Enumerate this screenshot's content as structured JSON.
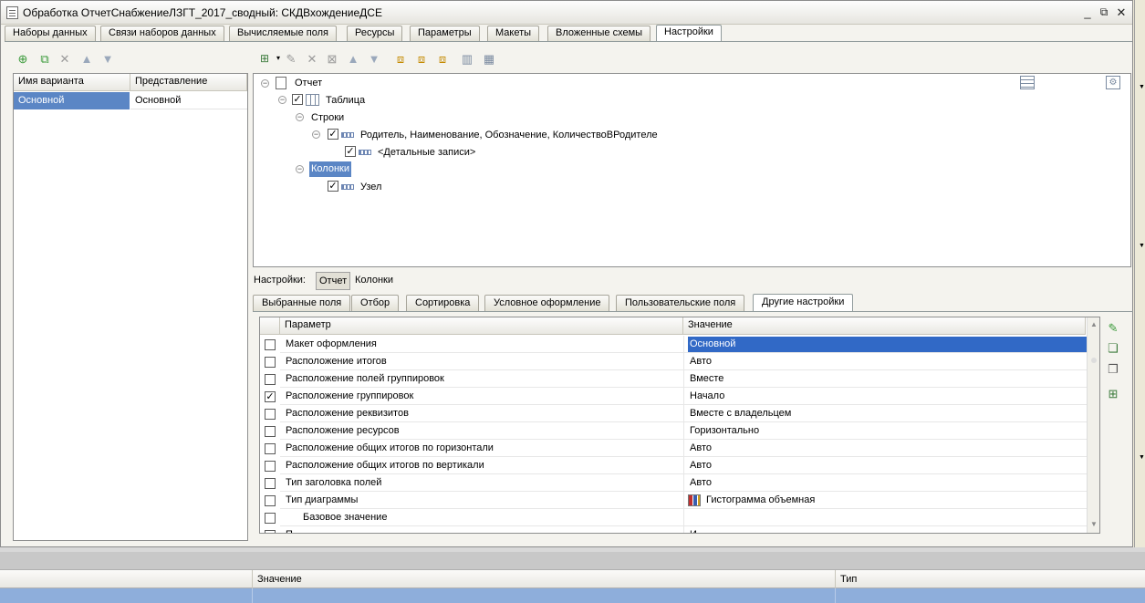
{
  "window": {
    "title": "Обработка ОтчетСнабжениеЛЗГТ_2017_сводный: СКДВхождениеДСЕ"
  },
  "tabs": [
    "Наборы данных",
    "Связи наборов данных",
    "Вычисляемые поля",
    "Ресурсы",
    "Параметры",
    "Макеты",
    "Вложенные схемы",
    "Настройки"
  ],
  "active_tab": "Настройки",
  "variants": {
    "col_name": "Имя варианта",
    "col_repr": "Представление",
    "rows": [
      {
        "name": "Основной",
        "repr": "Основной"
      }
    ]
  },
  "tree": {
    "root": "Отчет",
    "table": "Таблица",
    "rows": "Строки",
    "grouping": "Родитель, Наименование, Обозначение, КоличествоВРодителе",
    "detail": "<Детальные записи>",
    "columns": "Колонки",
    "node": "Узел"
  },
  "settings_bar": {
    "label": "Настройки:",
    "btn1": "Отчет",
    "btn2": "Колонки"
  },
  "subtabs": [
    "Выбранные поля",
    "Отбор",
    "Сортировка",
    "Условное оформление",
    "Пользовательские поля",
    "Другие настройки"
  ],
  "active_subtab": "Другие настройки",
  "params": {
    "col_param": "Параметр",
    "col_value": "Значение",
    "rows": [
      {
        "param": "Макет оформления",
        "value": "Основной",
        "checked": false,
        "selected": true
      },
      {
        "param": "Расположение итогов",
        "value": "Авто",
        "checked": false
      },
      {
        "param": "Расположение полей группировок",
        "value": "Вместе",
        "checked": false
      },
      {
        "param": "Расположение группировок",
        "value": "Начало",
        "checked": true
      },
      {
        "param": "Расположение реквизитов",
        "value": "Вместе с владельцем",
        "checked": false
      },
      {
        "param": "Расположение ресурсов",
        "value": "Горизонтально",
        "checked": false
      },
      {
        "param": "Расположение общих итогов по горизонтали",
        "value": "Авто",
        "checked": false
      },
      {
        "param": "Расположение общих итогов по вертикали",
        "value": "Авто",
        "checked": false
      },
      {
        "param": "Тип заголовка полей",
        "value": "Авто",
        "checked": false
      },
      {
        "param": "Тип диаграммы",
        "value": "Гистограмма объемная",
        "checked": false
      },
      {
        "param": "Базовое значение",
        "value": "",
        "checked": false,
        "indent": true
      },
      {
        "param": "П",
        "value": "И",
        "checked": false,
        "partial": true
      }
    ]
  },
  "bottom": {
    "col_value": "Значение",
    "col_type": "Тип"
  },
  "colors": {
    "selection": "#3169c6",
    "highlight": "#5b86c5",
    "bottom_row": "#8eaedb"
  }
}
